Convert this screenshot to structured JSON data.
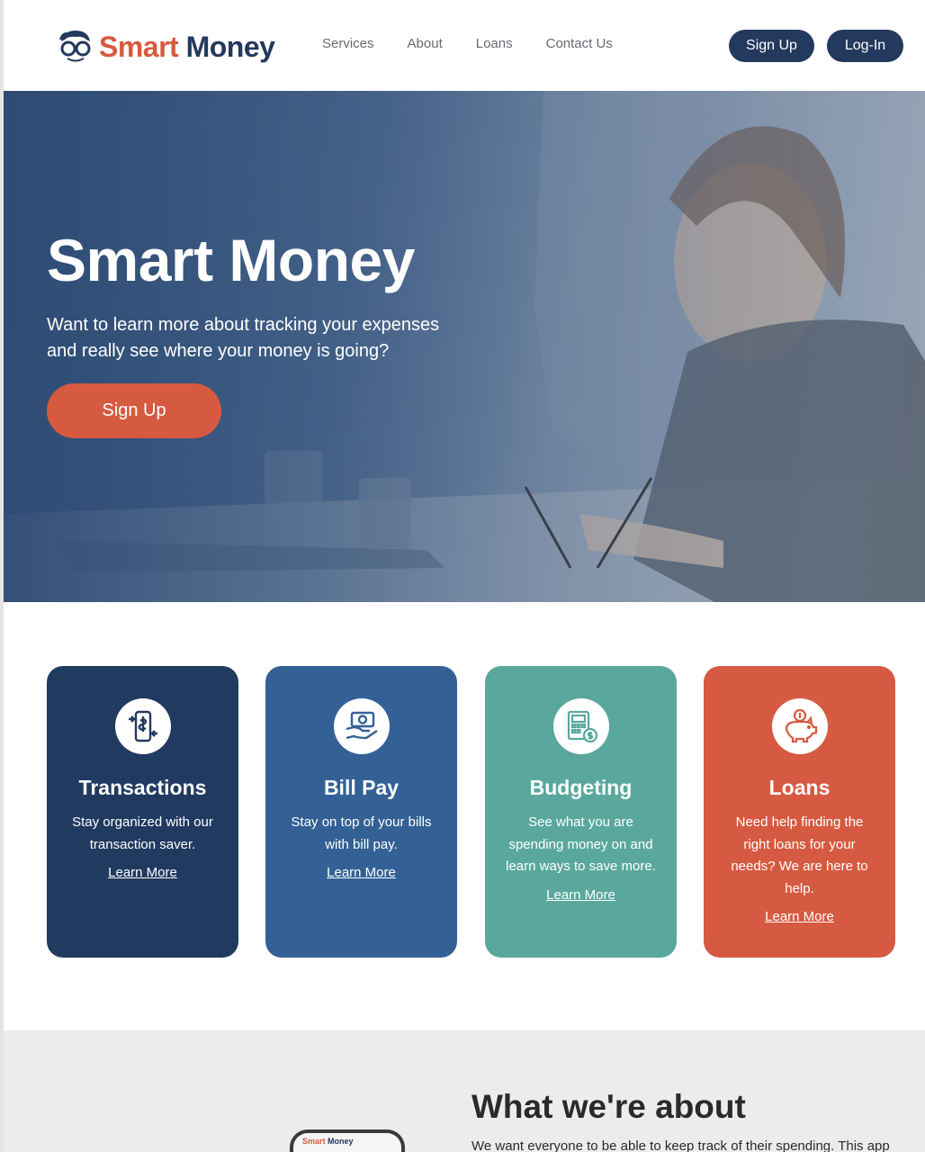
{
  "header": {
    "logo": {
      "word1": "Smart",
      "word2": "Money",
      "icon": "nerd-glasses-face-icon"
    },
    "nav": [
      "Services",
      "About",
      "Loans",
      "Contact Us"
    ],
    "signup_label": "Sign Up",
    "login_label": "Log-In"
  },
  "hero": {
    "title": "Smart Money",
    "subtitle": "Want to learn more about tracking your expenses and really see where your money is going?",
    "cta_label": "Sign Up",
    "overlay_color": "#33527a"
  },
  "cards": [
    {
      "title": "Transactions",
      "text": "Stay organized with our transaction saver.",
      "link": "Learn More",
      "icon": "phone-transfer-icon",
      "color": "#213a60"
    },
    {
      "title": "Bill Pay",
      "text": "Stay on top of your bills with bill pay.",
      "link": "Learn More",
      "icon": "hand-cash-icon",
      "color": "#336196"
    },
    {
      "title": "Budgeting",
      "text": "See what you are spending money on and learn ways to save more.",
      "link": "Learn More",
      "icon": "calculator-coin-icon",
      "color": "#5aa89d"
    },
    {
      "title": "Loans",
      "text": "Need help finding the right loans for your needs? We are here to help.",
      "link": "Learn More",
      "icon": "piggy-bank-icon",
      "color": "#d65a41"
    }
  ],
  "about": {
    "title": "What we're about",
    "text": "We want everyone to be able to keep track of their spending. This app",
    "phone_logo": {
      "word1": "Smart",
      "word2": "Money"
    }
  },
  "colors": {
    "brand_navy": "#23395d",
    "brand_orange": "#d65a3f"
  }
}
